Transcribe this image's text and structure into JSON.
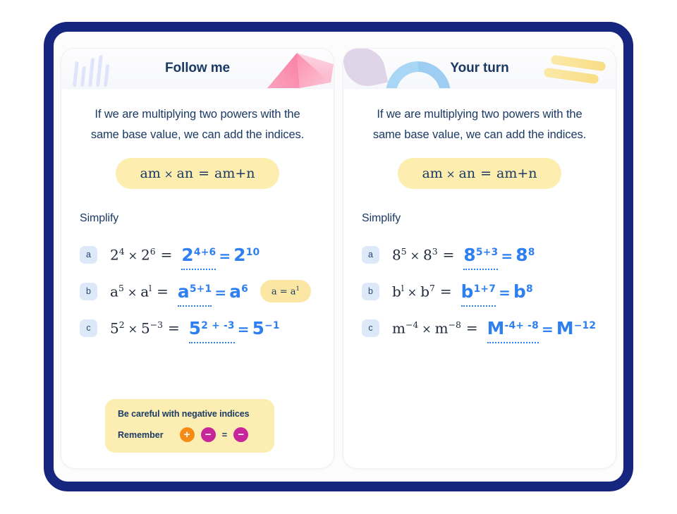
{
  "theme": {
    "frame_border": "#16257e",
    "heading_color": "#1b3a64",
    "handwriting_color": "#2e7ff0",
    "pill_yellow": "#fdeeb0",
    "badge_blue": "#dde9f8",
    "chip_plus": "#f58a14",
    "chip_minus": "#c7269a"
  },
  "panels": [
    {
      "id": "follow-me",
      "title": "Follow me",
      "rule_line_1": "If we are multiplying two powers with the",
      "rule_line_2": "same base value, we can add the indices.",
      "formula": {
        "base1": "a",
        "exp1": "m",
        "op": "×",
        "base2": "a",
        "exp2": "n",
        "eq": "=",
        "result_base": "a",
        "result_exp": "m+n"
      },
      "section_label": "Simplify",
      "decorations": [
        "bars-icon",
        "pyramid-icon"
      ],
      "problems": [
        {
          "letter": "a",
          "question": {
            "base1": "2",
            "exp1": "4",
            "op": "×",
            "base2": "2",
            "exp2": "6"
          },
          "answer_step": {
            "base": "2",
            "exp": "4+6"
          },
          "answer_final": {
            "base": "2",
            "exp": "10"
          }
        },
        {
          "letter": "b",
          "question": {
            "base1": "a",
            "exp1": "5",
            "op": "×",
            "base2": "a",
            "exp2": "l"
          },
          "answer_step": {
            "base": "a",
            "exp": "5+1"
          },
          "answer_final": {
            "base": "a",
            "exp": "6"
          },
          "hint": {
            "text": "a = a",
            "sup": "1"
          }
        },
        {
          "letter": "c",
          "question": {
            "base1": "5",
            "exp1": "2",
            "op": "×",
            "base2": "5",
            "exp2": "−3"
          },
          "answer_step": {
            "base": "5",
            "exp": "2 + -3"
          },
          "answer_final": {
            "base": "5",
            "exp": "−1"
          }
        }
      ],
      "reminder": {
        "title": "Be careful with negative indices",
        "label": "Remember",
        "chips": [
          "+",
          "−",
          "=",
          "−"
        ]
      }
    },
    {
      "id": "your-turn",
      "title": "Your turn",
      "rule_line_1": "If we are multiplying two powers with the",
      "rule_line_2": "same base value, we can add the indices.",
      "formula": {
        "base1": "a",
        "exp1": "m",
        "op": "×",
        "base2": "a",
        "exp2": "n",
        "eq": "=",
        "result_base": "a",
        "result_exp": "m+n"
      },
      "section_label": "Simplify",
      "decorations": [
        "leaf-icon",
        "arch-icon",
        "slashes-icon"
      ],
      "problems": [
        {
          "letter": "a",
          "question": {
            "base1": "8",
            "exp1": "5",
            "op": "×",
            "base2": "8",
            "exp2": "3"
          },
          "answer_step": {
            "base": "8",
            "exp": "5+3"
          },
          "answer_final": {
            "base": "8",
            "exp": "8"
          }
        },
        {
          "letter": "b",
          "question": {
            "base1": "b",
            "exp1": "l",
            "op": "×",
            "base2": "b",
            "exp2": "7"
          },
          "answer_step": {
            "base": "b",
            "exp": "1+7"
          },
          "answer_final": {
            "base": "b",
            "exp": "8"
          }
        },
        {
          "letter": "c",
          "question": {
            "base1": "m",
            "exp1": "−4",
            "op": "×",
            "base2": "m",
            "exp2": "−8"
          },
          "answer_step": {
            "base": "M",
            "exp": "-4+ -8"
          },
          "answer_final": {
            "base": "M",
            "exp": "−12"
          }
        }
      ]
    }
  ]
}
